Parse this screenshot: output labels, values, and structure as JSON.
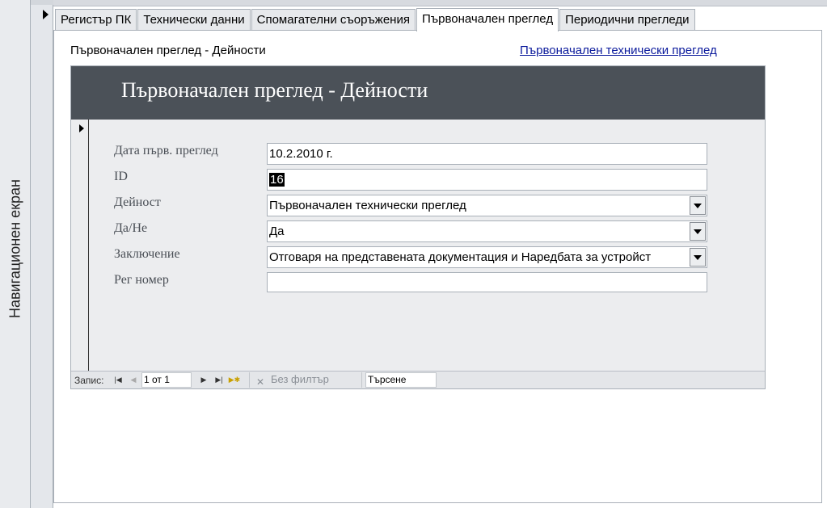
{
  "navigation_pane": {
    "label": "Навигационен екран"
  },
  "tabs": [
    {
      "label": "Регистър ПК",
      "active": false
    },
    {
      "label": "Технически данни",
      "active": false
    },
    {
      "label": "Спомагателни съоръжения",
      "active": false
    },
    {
      "label": "Първоначален преглед",
      "active": true
    },
    {
      "label": "Периодични прегледи",
      "active": false
    }
  ],
  "panel": {
    "section_title": "Първоначален преглед - Дейности",
    "link": "Първоначален технически преглед"
  },
  "subform": {
    "header_title": "Първоначален преглед - Дейности",
    "fields": {
      "date": {
        "label": "Дата първ. преглед",
        "value": "10.2.2010 г."
      },
      "id": {
        "label": "ID",
        "value": "16"
      },
      "activity": {
        "label": "Дейност",
        "value": "Първоначален технически преглед"
      },
      "yesno": {
        "label": "Да/Не",
        "value": "Да"
      },
      "conclusion": {
        "label": "Заключение",
        "value": "Отговаря на представената документация и Наредбата за устройст"
      },
      "reg": {
        "label": "Рег номер",
        "value": ""
      }
    }
  },
  "record_nav": {
    "label": "Запис:",
    "current": "1 от 1",
    "filter": "Без филтър",
    "search": "Търсене",
    "first_icon": "first-record-icon",
    "prev_icon": "previous-record-icon",
    "next_icon": "next-record-icon",
    "last_icon": "last-record-icon",
    "new_icon": "new-record-icon"
  },
  "colors": {
    "header_bg": "#4b5158",
    "body_bg": "#ecedef",
    "link": "#0b1a9c",
    "label": "#4a4f56"
  }
}
